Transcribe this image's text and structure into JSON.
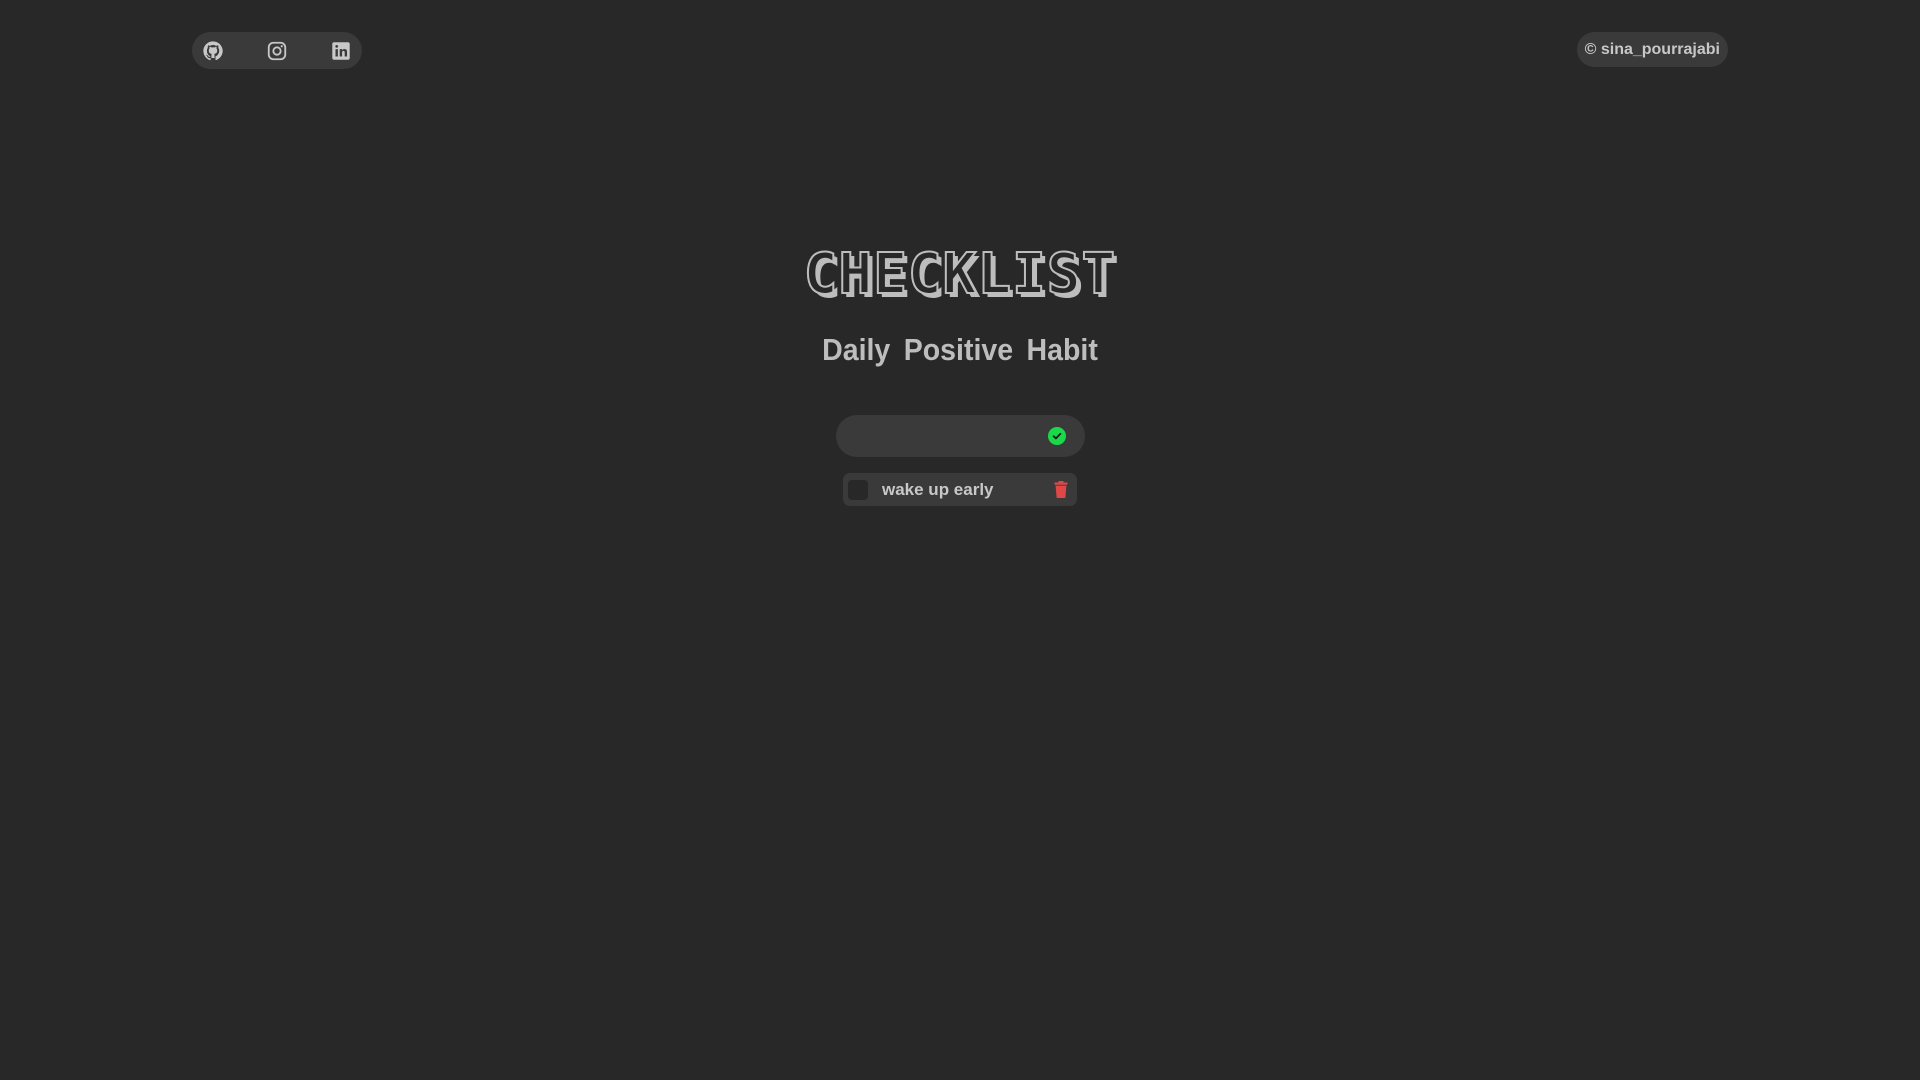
{
  "social": {
    "items": [
      {
        "name": "github",
        "icon": "github-icon"
      },
      {
        "name": "instagram",
        "icon": "instagram-icon"
      },
      {
        "name": "linkedin",
        "icon": "linkedin-icon"
      }
    ]
  },
  "copyright": {
    "text": "© sina_pourrajabi"
  },
  "header": {
    "title": "CHECKLIST",
    "subtitle": "Daily Positive Habit"
  },
  "input": {
    "value": "",
    "placeholder": "",
    "add_icon": "check-circle-icon"
  },
  "tasks": [
    {
      "label": "wake up early",
      "checked": false,
      "delete_icon": "trash-icon"
    }
  ],
  "colors": {
    "background": "#282828",
    "surface": "#3a3a3a",
    "text": "#bdbdbd",
    "accent_green": "#19d94b",
    "delete_red": "#e04848"
  }
}
